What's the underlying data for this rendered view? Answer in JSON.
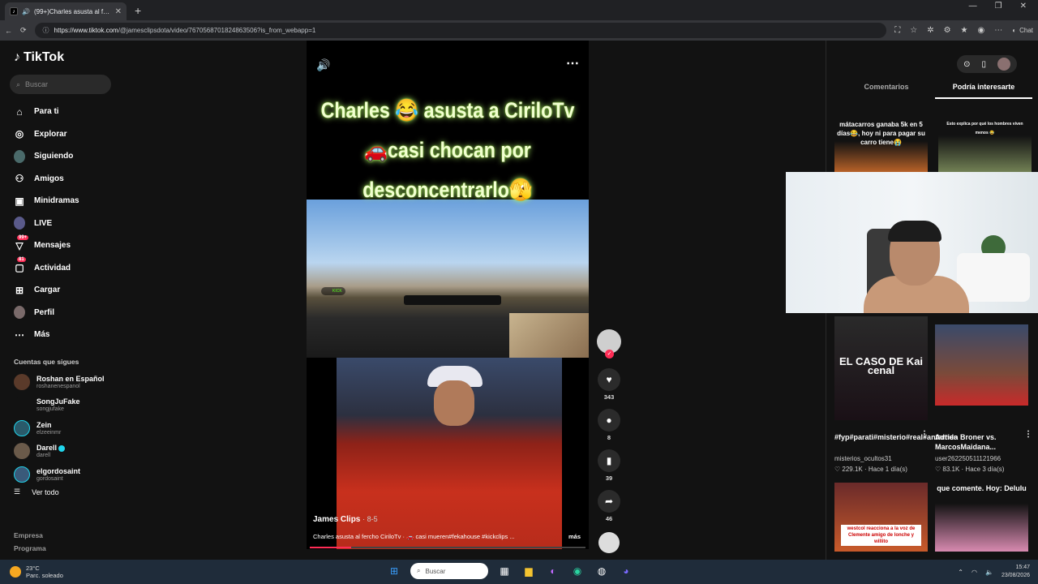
{
  "browser": {
    "tab_title": "(99+)Charles asusta al fercho",
    "tab_close": "✕",
    "new_tab": "+",
    "url_host": "https://www.tiktok.com",
    "url_path": "/@jamesclipsdota/video/7670568701824863506?is_from_webapp=1",
    "chat_label": "Chat",
    "window_controls": [
      "—",
      "❐",
      "✕"
    ]
  },
  "sidebar": {
    "logo": "TikTok",
    "search_placeholder": "Buscar",
    "nav": [
      {
        "label": "Para ti",
        "icon": "home-icon"
      },
      {
        "label": "Explorar",
        "icon": "compass-icon"
      },
      {
        "label": "Siguiendo",
        "icon": "following-avatar"
      },
      {
        "label": "Amigos",
        "icon": "friends-icon"
      },
      {
        "label": "Minidramas",
        "icon": "minidrama-icon"
      },
      {
        "label": "LIVE",
        "icon": "live-avatar"
      },
      {
        "label": "Mensajes",
        "icon": "message-icon",
        "badge": "99+"
      },
      {
        "label": "Actividad",
        "icon": "activity-icon",
        "badge": "81"
      },
      {
        "label": "Cargar",
        "icon": "upload-icon"
      },
      {
        "label": "Perfil",
        "icon": "profile-avatar"
      },
      {
        "label": "Más",
        "icon": "more-icon"
      }
    ],
    "following_title": "Cuentas que sigues",
    "following": [
      {
        "name": "Roshan en Español",
        "user": "roshanenespanol"
      },
      {
        "name": "SongJuFake",
        "user": "songjufake"
      },
      {
        "name": "Zein",
        "user": "elzeeinmr"
      },
      {
        "name": "Darell",
        "user": "darell"
      },
      {
        "name": "elgordosaint",
        "user": "gordosaint"
      }
    ],
    "see_all": "Ver todo",
    "footer": [
      "Empresa",
      "Programa"
    ]
  },
  "video": {
    "caption_overlay": "Charles 😂 asusta a CiriloTv 🚗casi chocan por desconcentrarlo🫣",
    "kick_tag": "KICK",
    "author": "James Clips",
    "date": "· 8-5",
    "description": "Charles asusta al fercho CiriloTv · 🚗 casi mueren#fekahouse #kickclips ...",
    "more": "más",
    "progress": 0.15,
    "likes": "343",
    "comments": "8",
    "saves": "39",
    "shares": "46"
  },
  "right_panel": {
    "tabs": [
      "Comentarios",
      "Podría interesarte"
    ],
    "active_tab": "Podría interesarte",
    "cards": [
      {
        "overlay": "mátacarros ganaba 5k en 5 días😂, hoy ni para pagar su carro tiene😭"
      },
      {
        "overlay": "Esto explica por qué los hombres viven menos 😂"
      },
      {
        "overlay": "EL CASO DE Kai cenal",
        "title": "#fyp#parati#misterio#real#antartida",
        "user": "misterios_ocultos31",
        "likes": "229.1K",
        "time": "Hace 1 día(s)"
      },
      {
        "overlay": "",
        "title": "Adrien Broner vs. MarcosMaidana...",
        "user": "user262250511121966",
        "likes": "83.1K",
        "time": "Hace 3 día(s)"
      },
      {
        "overlay": "westcol reacciona a la voz de Clemente amigo de lonche y willito"
      },
      {
        "overlay": "que comente. Hoy: Delulu"
      }
    ]
  },
  "taskbar": {
    "temperature": "23°C",
    "weather": "Parc. soleado",
    "search": "Buscar",
    "time": "15:47",
    "date": "23/08/2026"
  }
}
